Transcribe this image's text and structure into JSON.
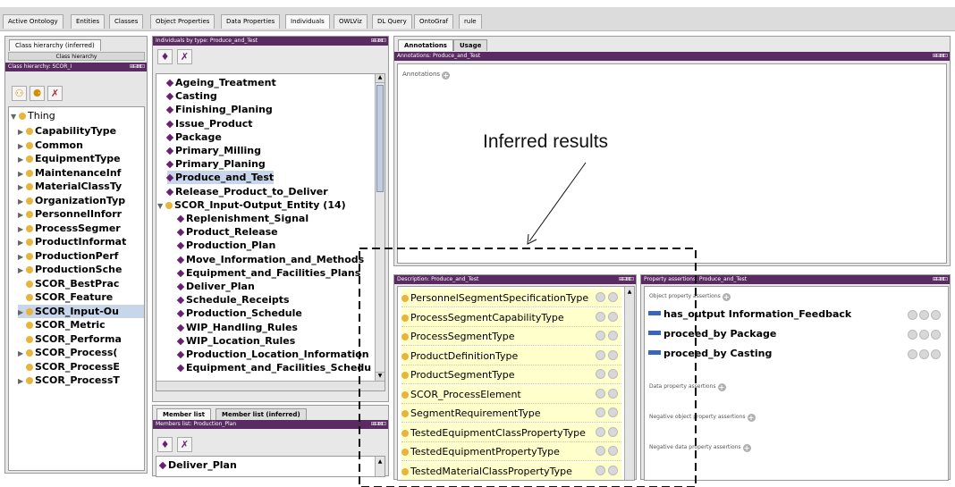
{
  "tabs": [
    "Active Ontology",
    "Entities",
    "Classes",
    "Object Properties",
    "Data Properties",
    "Individuals",
    "OWLViz",
    "DL Query",
    "OntoGraf",
    "rule"
  ],
  "active_tab": "Individuals",
  "class_panel": {
    "tab_label": "Class hierarchy (inferred)",
    "sub_label": "Class hierarchy",
    "title": "Class hierarchy: SCOR_I",
    "root": "Thing",
    "items": [
      "CapabilityType",
      "Common",
      "EquipmentType",
      "MaintenanceInf",
      "MaterialClassTy",
      "OrganizationTyp",
      "PersonnelInforr",
      "ProcessSegmer",
      "ProductInformat",
      "ProductionPerf",
      "ProductionSche",
      "SCOR_BestPrac",
      "SCOR_Feature",
      "SCOR_Input-Ou",
      "SCOR_Metric",
      "SCOR_Performa",
      "SCOR_Process(",
      "SCOR_ProcessE",
      "SCOR_ProcessT"
    ]
  },
  "individuals_panel": {
    "title": "Individuals by type: Produce_and_Test",
    "items": [
      "Ageing_Treatment",
      "Casting",
      "Finishing_Planing",
      "Issue_Product",
      "Package",
      "Primary_Milling",
      "Primary_Planing",
      "Produce_and_Test",
      "Release_Product_to_Deliver"
    ],
    "group": "SCOR_Input-Output_Entity (14)",
    "group_items": [
      "Replenishment_Signal",
      "Product_Release",
      "Production_Plan",
      "Move_Information_and_Methods",
      "Equipment_and_Facilities_Plans",
      "Deliver_Plan",
      "Schedule_Receipts",
      "Production_Schedule",
      "WIP_Handling_Rules",
      "WIP_Location_Rules",
      "Production_Location_Information",
      "Equipment_and_Facilities_Schedu"
    ]
  },
  "members_panel": {
    "tab1": "Member list",
    "tab2": "Member list (inferred)",
    "title": "Members list: Production_Plan",
    "first_item": "Deliver_Plan"
  },
  "annotations_panel": {
    "tab1": "Annotations",
    "tab2": "Usage",
    "title": "Annotations: Produce_and_Test",
    "label": "Annotations"
  },
  "overlay_text": "Inferred results",
  "description_panel": {
    "title": "Description: Produce_and_Test",
    "items": [
      "PersonnelSegmentSpecificationType",
      "ProcessSegmentCapabilityType",
      "ProcessSegmentType",
      "ProductDefinitionType",
      "ProductSegmentType",
      "SCOR_ProcessElement",
      "SegmentRequirementType",
      "TestedEquipmentClassPropertyType",
      "TestedEquipmentPropertyType",
      "TestedMaterialClassPropertyType"
    ]
  },
  "property_panel": {
    "title": "Property assertions: Produce_and_Test",
    "obj_label": "Object property assertions",
    "items": [
      "has_output Information_Feedback",
      "proceed_by Package",
      "proceed_by Casting"
    ],
    "data_label": "Data property assertions",
    "neg_obj_label": "Negative object property assertions",
    "neg_data_label": "Negative data property assertions"
  },
  "panel_controls": "⊞⊟⊠⊡",
  "scroll_up": "▲",
  "scroll_down": "▼"
}
